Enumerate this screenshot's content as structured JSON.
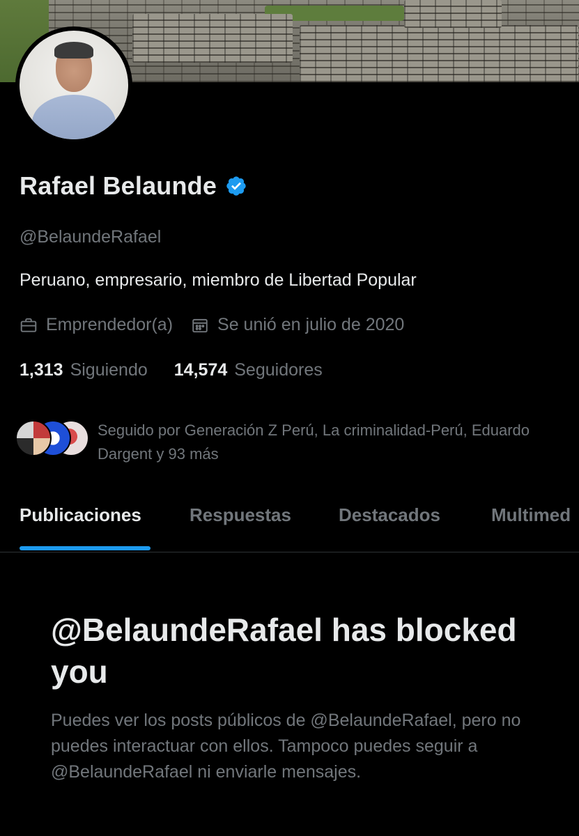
{
  "profile": {
    "name": "Rafael Belaunde",
    "handle": "@BelaundeRafael",
    "bio": "Peruano, empresario, miembro de Libertad Popular",
    "category": "Emprendedor(a)",
    "joined": "Se unió en julio de 2020",
    "following_count": "1,313",
    "following_label": "Siguiendo",
    "followers_count": "14,574",
    "followers_label": "Seguidores",
    "followed_by": "Seguido por Generación Z Perú, La criminalidad-Perú, Eduardo Dargent y 93 más",
    "verified_color": "#1d9bf0"
  },
  "tabs": [
    {
      "label": "Publicaciones",
      "active": true
    },
    {
      "label": "Respuestas",
      "active": false
    },
    {
      "label": "Destacados",
      "active": false
    },
    {
      "label": "Multimed",
      "active": false
    }
  ],
  "blocked": {
    "title": "@BelaundeRafael has blocked you",
    "body": "Puedes ver los posts públicos de @BelaundeRafael, pero no puedes interactuar con ellos. Tampoco puedes seguir a @BelaundeRafael ni enviarle mensajes."
  },
  "icons": {
    "verified": "verified-badge-icon",
    "category": "briefcase-icon",
    "joined": "calendar-icon"
  },
  "colors": {
    "background": "#000000",
    "primary_text": "#e7e9ea",
    "secondary_text": "#71767b",
    "accent": "#1d9bf0",
    "divider": "#2f3336"
  }
}
